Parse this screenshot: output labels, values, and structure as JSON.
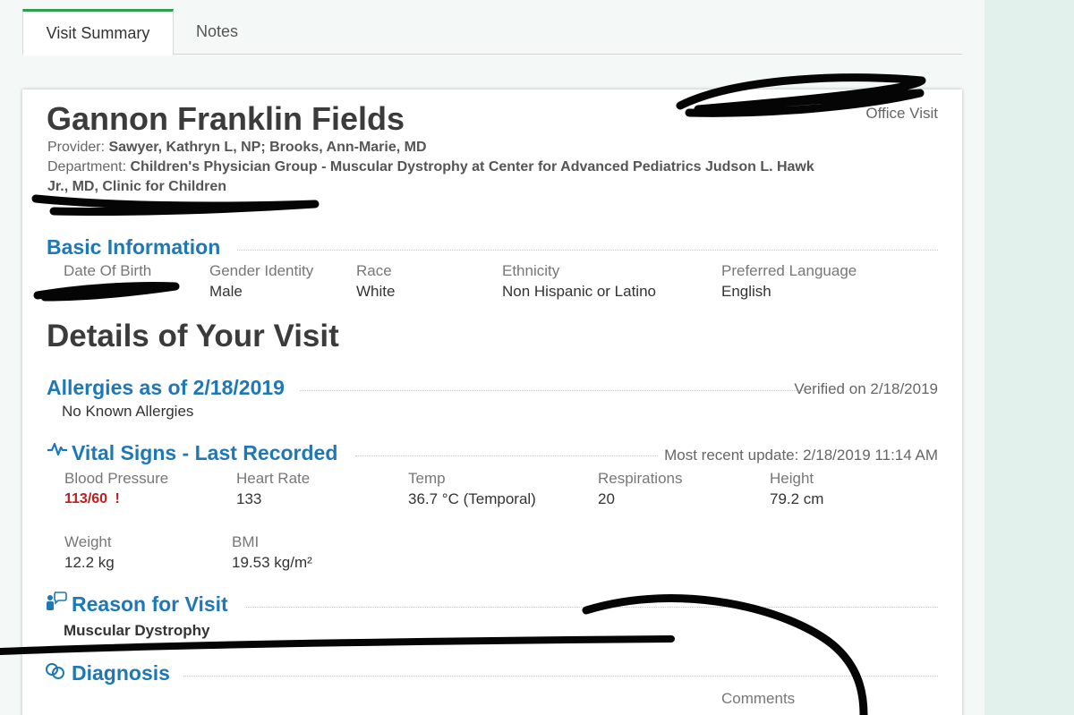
{
  "tabs": [
    {
      "label": "Visit Summary",
      "active": true
    },
    {
      "label": "Notes",
      "active": false
    }
  ],
  "header": {
    "patient_name": "Gannon Franklin Fields",
    "visit_type": "Office Visit",
    "provider_label": "Provider:",
    "provider_value": "Sawyer, Kathryn L, NP; Brooks, Ann-Marie, MD",
    "department_label": "Department:",
    "department_value_line1": "Children's Physician Group - Muscular Dystrophy at Center for Advanced Pediatrics Judson L. Hawk",
    "department_value_line2": "Jr., MD, Clinic for Children"
  },
  "basic_info": {
    "title": "Basic Information",
    "dob_label": "Date Of Birth",
    "gender_label": "Gender Identity",
    "gender_value": "Male",
    "race_label": "Race",
    "race_value": "White",
    "ethnicity_label": "Ethnicity",
    "ethnicity_value": "Non Hispanic or Latino",
    "language_label": "Preferred Language",
    "language_value": "English"
  },
  "details": {
    "title": "Details of Your Visit"
  },
  "allergies": {
    "title": "Allergies as of 2/18/2019",
    "verified": "Verified on 2/18/2019",
    "value": "No Known Allergies"
  },
  "vitals": {
    "title": "Vital Signs - Last Recorded",
    "updated": "Most recent update: 2/18/2019 11:14 AM",
    "bp_label": "Blood Pressure",
    "bp_value": "113/60",
    "bp_flag": "!",
    "hr_label": "Heart Rate",
    "hr_value": "133",
    "temp_label": "Temp",
    "temp_value": "36.7 °C (Temporal)",
    "resp_label": "Respirations",
    "resp_value": "20",
    "height_label": "Height",
    "height_value": "79.2 cm",
    "weight_label": "Weight",
    "weight_value": "12.2 kg",
    "bmi_label": "BMI",
    "bmi_value": "19.53 kg/m²"
  },
  "reason": {
    "title": "Reason for Visit",
    "value": "Muscular Dystrophy"
  },
  "diagnosis": {
    "title": "Diagnosis",
    "comments_label": "Comments"
  },
  "icons": {
    "vitals": "heartbeat-icon",
    "reason": "person-speech-icon",
    "diagnosis": "diagnosis-icon"
  },
  "colors": {
    "section_title": "#1f78b6",
    "tab_accent": "#2e9e4e",
    "alert": "#c21d1d"
  }
}
